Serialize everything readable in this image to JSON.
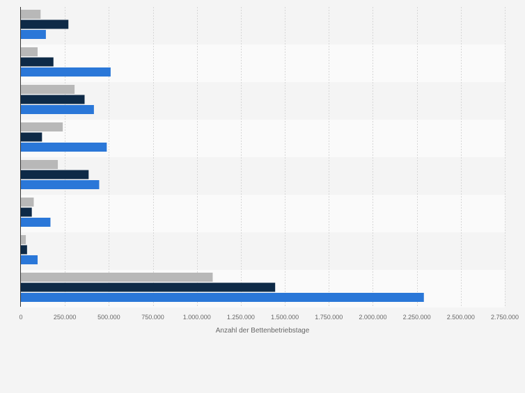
{
  "chart_data": {
    "type": "bar",
    "orientation": "horizontal",
    "categories": [
      "",
      "",
      "",
      "",
      "",
      "",
      "",
      ""
    ],
    "series": [
      {
        "color": "#b8b8b8",
        "values": [
          112000,
          95000,
          305000,
          238000,
          210000,
          73000,
          28000,
          1090000
        ]
      },
      {
        "color": "#0e2a47",
        "values": [
          270000,
          185000,
          362000,
          120000,
          385000,
          62000,
          35000,
          1445000
        ]
      },
      {
        "color": "#2a77d8",
        "values": [
          142000,
          510000,
          415000,
          488000,
          445000,
          168000,
          95000,
          2290000
        ]
      }
    ],
    "xlabel": "Anzahl der Bettenbetriebstage",
    "ylabel": "",
    "xlim": [
      0,
      2750000
    ],
    "xticks": [
      0,
      250000,
      500000,
      750000,
      1000000,
      1250000,
      1500000,
      1750000,
      2000000,
      2250000,
      2500000,
      2750000
    ],
    "xtick_labels": [
      "0",
      "250.000",
      "500.000",
      "750.000",
      "1.000.000",
      "1.250.000",
      "1.500.000",
      "1.750.000",
      "2.000.000",
      "2.250.000",
      "2.500.000",
      "2.750.000"
    ],
    "grid": true,
    "legend": "none"
  }
}
